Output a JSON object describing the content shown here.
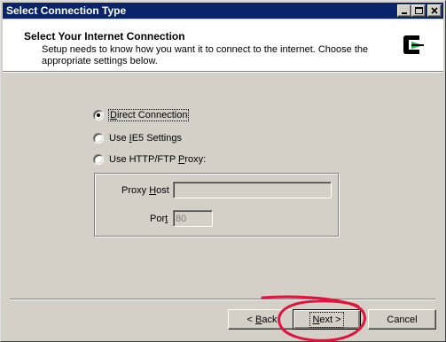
{
  "window": {
    "title": "Select Connection Type",
    "controls": [
      "minimize-icon",
      "maximize-icon",
      "close-icon"
    ]
  },
  "header": {
    "title": "Select Your Internet Connection",
    "subtitle": "Setup needs to know how you want it to connect to the internet.  Choose the appropriate settings below.",
    "logo_icon": "connection-logo-icon"
  },
  "options": [
    {
      "pre": "",
      "key": "D",
      "post": "irect Connection",
      "checked": true
    },
    {
      "pre": "Use ",
      "key": "I",
      "post": "E5 Settings",
      "checked": false
    },
    {
      "pre": "Use HTTP/FTP ",
      "key": "P",
      "post": "roxy:",
      "checked": false
    }
  ],
  "proxy": {
    "host_pre": "Proxy ",
    "host_key": "H",
    "host_post": "ost",
    "host_value": "",
    "port_pre": "Por",
    "port_key": "t",
    "port_post": "",
    "port_value": "80"
  },
  "buttons": {
    "back_pre": "< ",
    "back_key": "B",
    "back_post": "ack",
    "next_pre": "",
    "next_key": "N",
    "next_post": "ext >",
    "cancel": "Cancel"
  },
  "colors": {
    "titlebar": "#0a246a",
    "face": "#d4d0c8",
    "annotation": "#e0143c",
    "logo_green": "#21b14b"
  }
}
